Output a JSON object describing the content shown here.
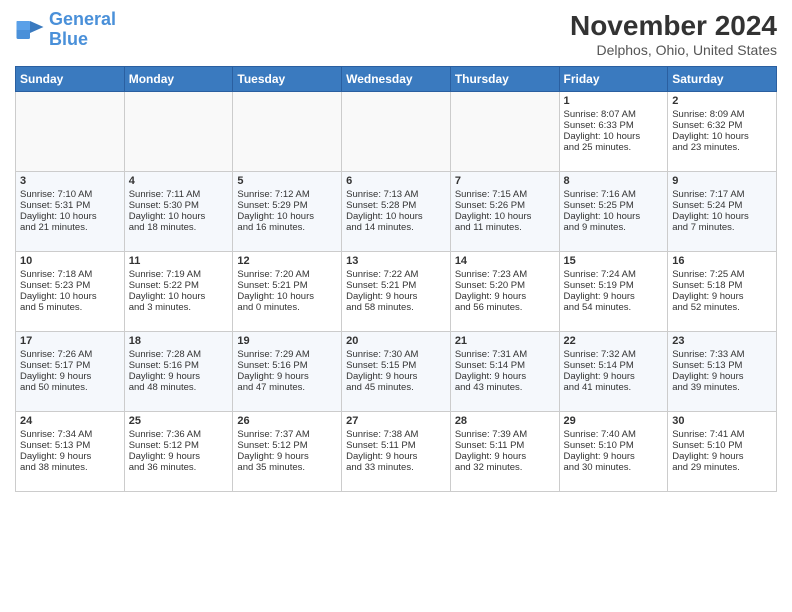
{
  "header": {
    "logo_line1": "General",
    "logo_line2": "Blue",
    "month": "November 2024",
    "location": "Delphos, Ohio, United States"
  },
  "weekdays": [
    "Sunday",
    "Monday",
    "Tuesday",
    "Wednesday",
    "Thursday",
    "Friday",
    "Saturday"
  ],
  "weeks": [
    [
      {
        "day": "",
        "info": ""
      },
      {
        "day": "",
        "info": ""
      },
      {
        "day": "",
        "info": ""
      },
      {
        "day": "",
        "info": ""
      },
      {
        "day": "",
        "info": ""
      },
      {
        "day": "1",
        "info": "Sunrise: 8:07 AM\nSunset: 6:33 PM\nDaylight: 10 hours\nand 25 minutes."
      },
      {
        "day": "2",
        "info": "Sunrise: 8:09 AM\nSunset: 6:32 PM\nDaylight: 10 hours\nand 23 minutes."
      }
    ],
    [
      {
        "day": "3",
        "info": "Sunrise: 7:10 AM\nSunset: 5:31 PM\nDaylight: 10 hours\nand 21 minutes."
      },
      {
        "day": "4",
        "info": "Sunrise: 7:11 AM\nSunset: 5:30 PM\nDaylight: 10 hours\nand 18 minutes."
      },
      {
        "day": "5",
        "info": "Sunrise: 7:12 AM\nSunset: 5:29 PM\nDaylight: 10 hours\nand 16 minutes."
      },
      {
        "day": "6",
        "info": "Sunrise: 7:13 AM\nSunset: 5:28 PM\nDaylight: 10 hours\nand 14 minutes."
      },
      {
        "day": "7",
        "info": "Sunrise: 7:15 AM\nSunset: 5:26 PM\nDaylight: 10 hours\nand 11 minutes."
      },
      {
        "day": "8",
        "info": "Sunrise: 7:16 AM\nSunset: 5:25 PM\nDaylight: 10 hours\nand 9 minutes."
      },
      {
        "day": "9",
        "info": "Sunrise: 7:17 AM\nSunset: 5:24 PM\nDaylight: 10 hours\nand 7 minutes."
      }
    ],
    [
      {
        "day": "10",
        "info": "Sunrise: 7:18 AM\nSunset: 5:23 PM\nDaylight: 10 hours\nand 5 minutes."
      },
      {
        "day": "11",
        "info": "Sunrise: 7:19 AM\nSunset: 5:22 PM\nDaylight: 10 hours\nand 3 minutes."
      },
      {
        "day": "12",
        "info": "Sunrise: 7:20 AM\nSunset: 5:21 PM\nDaylight: 10 hours\nand 0 minutes."
      },
      {
        "day": "13",
        "info": "Sunrise: 7:22 AM\nSunset: 5:21 PM\nDaylight: 9 hours\nand 58 minutes."
      },
      {
        "day": "14",
        "info": "Sunrise: 7:23 AM\nSunset: 5:20 PM\nDaylight: 9 hours\nand 56 minutes."
      },
      {
        "day": "15",
        "info": "Sunrise: 7:24 AM\nSunset: 5:19 PM\nDaylight: 9 hours\nand 54 minutes."
      },
      {
        "day": "16",
        "info": "Sunrise: 7:25 AM\nSunset: 5:18 PM\nDaylight: 9 hours\nand 52 minutes."
      }
    ],
    [
      {
        "day": "17",
        "info": "Sunrise: 7:26 AM\nSunset: 5:17 PM\nDaylight: 9 hours\nand 50 minutes."
      },
      {
        "day": "18",
        "info": "Sunrise: 7:28 AM\nSunset: 5:16 PM\nDaylight: 9 hours\nand 48 minutes."
      },
      {
        "day": "19",
        "info": "Sunrise: 7:29 AM\nSunset: 5:16 PM\nDaylight: 9 hours\nand 47 minutes."
      },
      {
        "day": "20",
        "info": "Sunrise: 7:30 AM\nSunset: 5:15 PM\nDaylight: 9 hours\nand 45 minutes."
      },
      {
        "day": "21",
        "info": "Sunrise: 7:31 AM\nSunset: 5:14 PM\nDaylight: 9 hours\nand 43 minutes."
      },
      {
        "day": "22",
        "info": "Sunrise: 7:32 AM\nSunset: 5:14 PM\nDaylight: 9 hours\nand 41 minutes."
      },
      {
        "day": "23",
        "info": "Sunrise: 7:33 AM\nSunset: 5:13 PM\nDaylight: 9 hours\nand 39 minutes."
      }
    ],
    [
      {
        "day": "24",
        "info": "Sunrise: 7:34 AM\nSunset: 5:13 PM\nDaylight: 9 hours\nand 38 minutes."
      },
      {
        "day": "25",
        "info": "Sunrise: 7:36 AM\nSunset: 5:12 PM\nDaylight: 9 hours\nand 36 minutes."
      },
      {
        "day": "26",
        "info": "Sunrise: 7:37 AM\nSunset: 5:12 PM\nDaylight: 9 hours\nand 35 minutes."
      },
      {
        "day": "27",
        "info": "Sunrise: 7:38 AM\nSunset: 5:11 PM\nDaylight: 9 hours\nand 33 minutes."
      },
      {
        "day": "28",
        "info": "Sunrise: 7:39 AM\nSunset: 5:11 PM\nDaylight: 9 hours\nand 32 minutes."
      },
      {
        "day": "29",
        "info": "Sunrise: 7:40 AM\nSunset: 5:10 PM\nDaylight: 9 hours\nand 30 minutes."
      },
      {
        "day": "30",
        "info": "Sunrise: 7:41 AM\nSunset: 5:10 PM\nDaylight: 9 hours\nand 29 minutes."
      }
    ]
  ]
}
